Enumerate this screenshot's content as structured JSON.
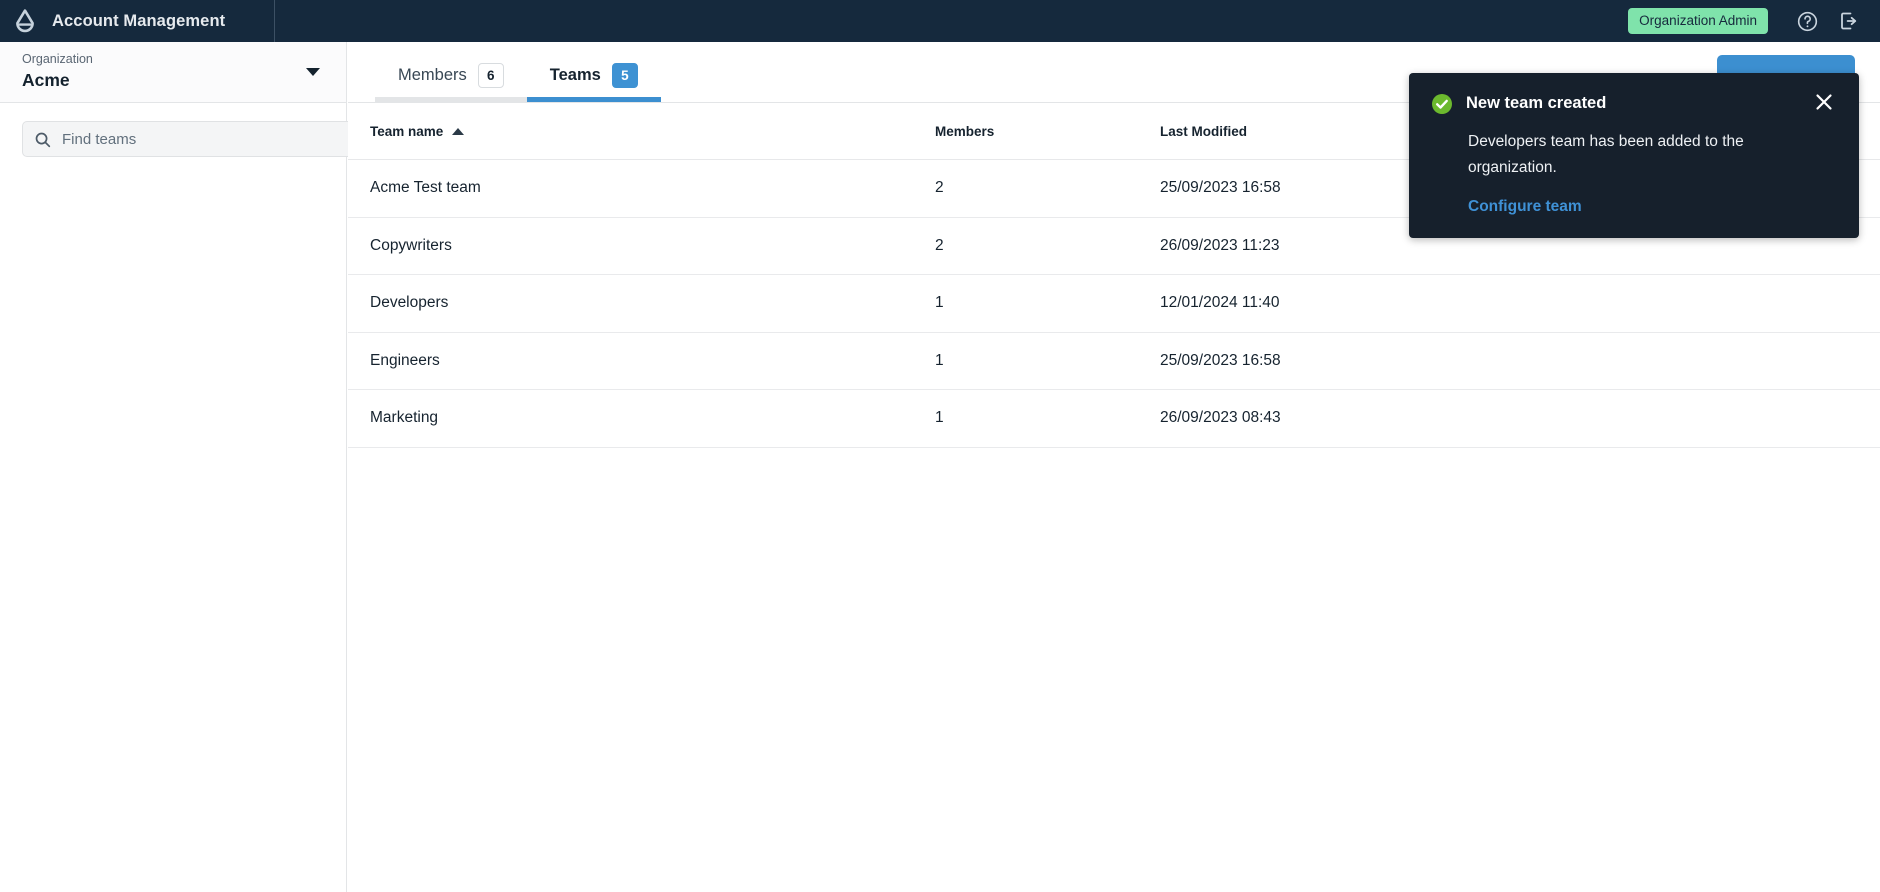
{
  "header": {
    "logo_icon": "alfresco-trefoil-logo",
    "app_title": "Account Management",
    "role_badge": "Organization Admin",
    "help_icon": "help-circle-icon",
    "logout_icon": "logout-icon",
    "background_color": "#15293d",
    "badge_color": "#7fe3ab"
  },
  "sidebar": {
    "org_label": "Organization",
    "org_name": "Acme",
    "caret_icon": "chevron-down-icon",
    "search": {
      "icon": "search-icon",
      "placeholder": "Find teams",
      "value": ""
    }
  },
  "main": {
    "tabs": [
      {
        "label": "Members",
        "count": "6",
        "active": false
      },
      {
        "label": "Teams",
        "count": "5",
        "active": true
      }
    ],
    "primary_action": {
      "label": "",
      "color": "#3c8fd0",
      "obscured_by_toast": true
    },
    "accent_color": "#3c8fd0"
  },
  "table": {
    "columns": [
      {
        "key": "name",
        "label": "Team name",
        "sorted": true,
        "sort_icon": "sort-ascending-icon"
      },
      {
        "key": "members",
        "label": "Members",
        "sorted": false
      },
      {
        "key": "modified",
        "label": "Last Modified",
        "sorted": false
      }
    ],
    "rows": [
      {
        "name": "Acme Test team",
        "members": "2",
        "modified": "25/09/2023 16:58"
      },
      {
        "name": "Copywriters",
        "members": "2",
        "modified": "26/09/2023 11:23"
      },
      {
        "name": "Developers",
        "members": "1",
        "modified": "12/01/2024 11:40"
      },
      {
        "name": "Engineers",
        "members": "1",
        "modified": "25/09/2023 16:58"
      },
      {
        "name": "Marketing",
        "members": "1",
        "modified": "26/09/2023 08:43"
      }
    ]
  },
  "toast": {
    "status_icon": "success-check-icon",
    "title": "New team created",
    "body": "Developers team has been added to the organization.",
    "link_label": "Configure team",
    "close_icon": "close-icon",
    "background_color": "#16202c",
    "icon_color": "#6cb92e",
    "link_color": "#3f91d6"
  }
}
